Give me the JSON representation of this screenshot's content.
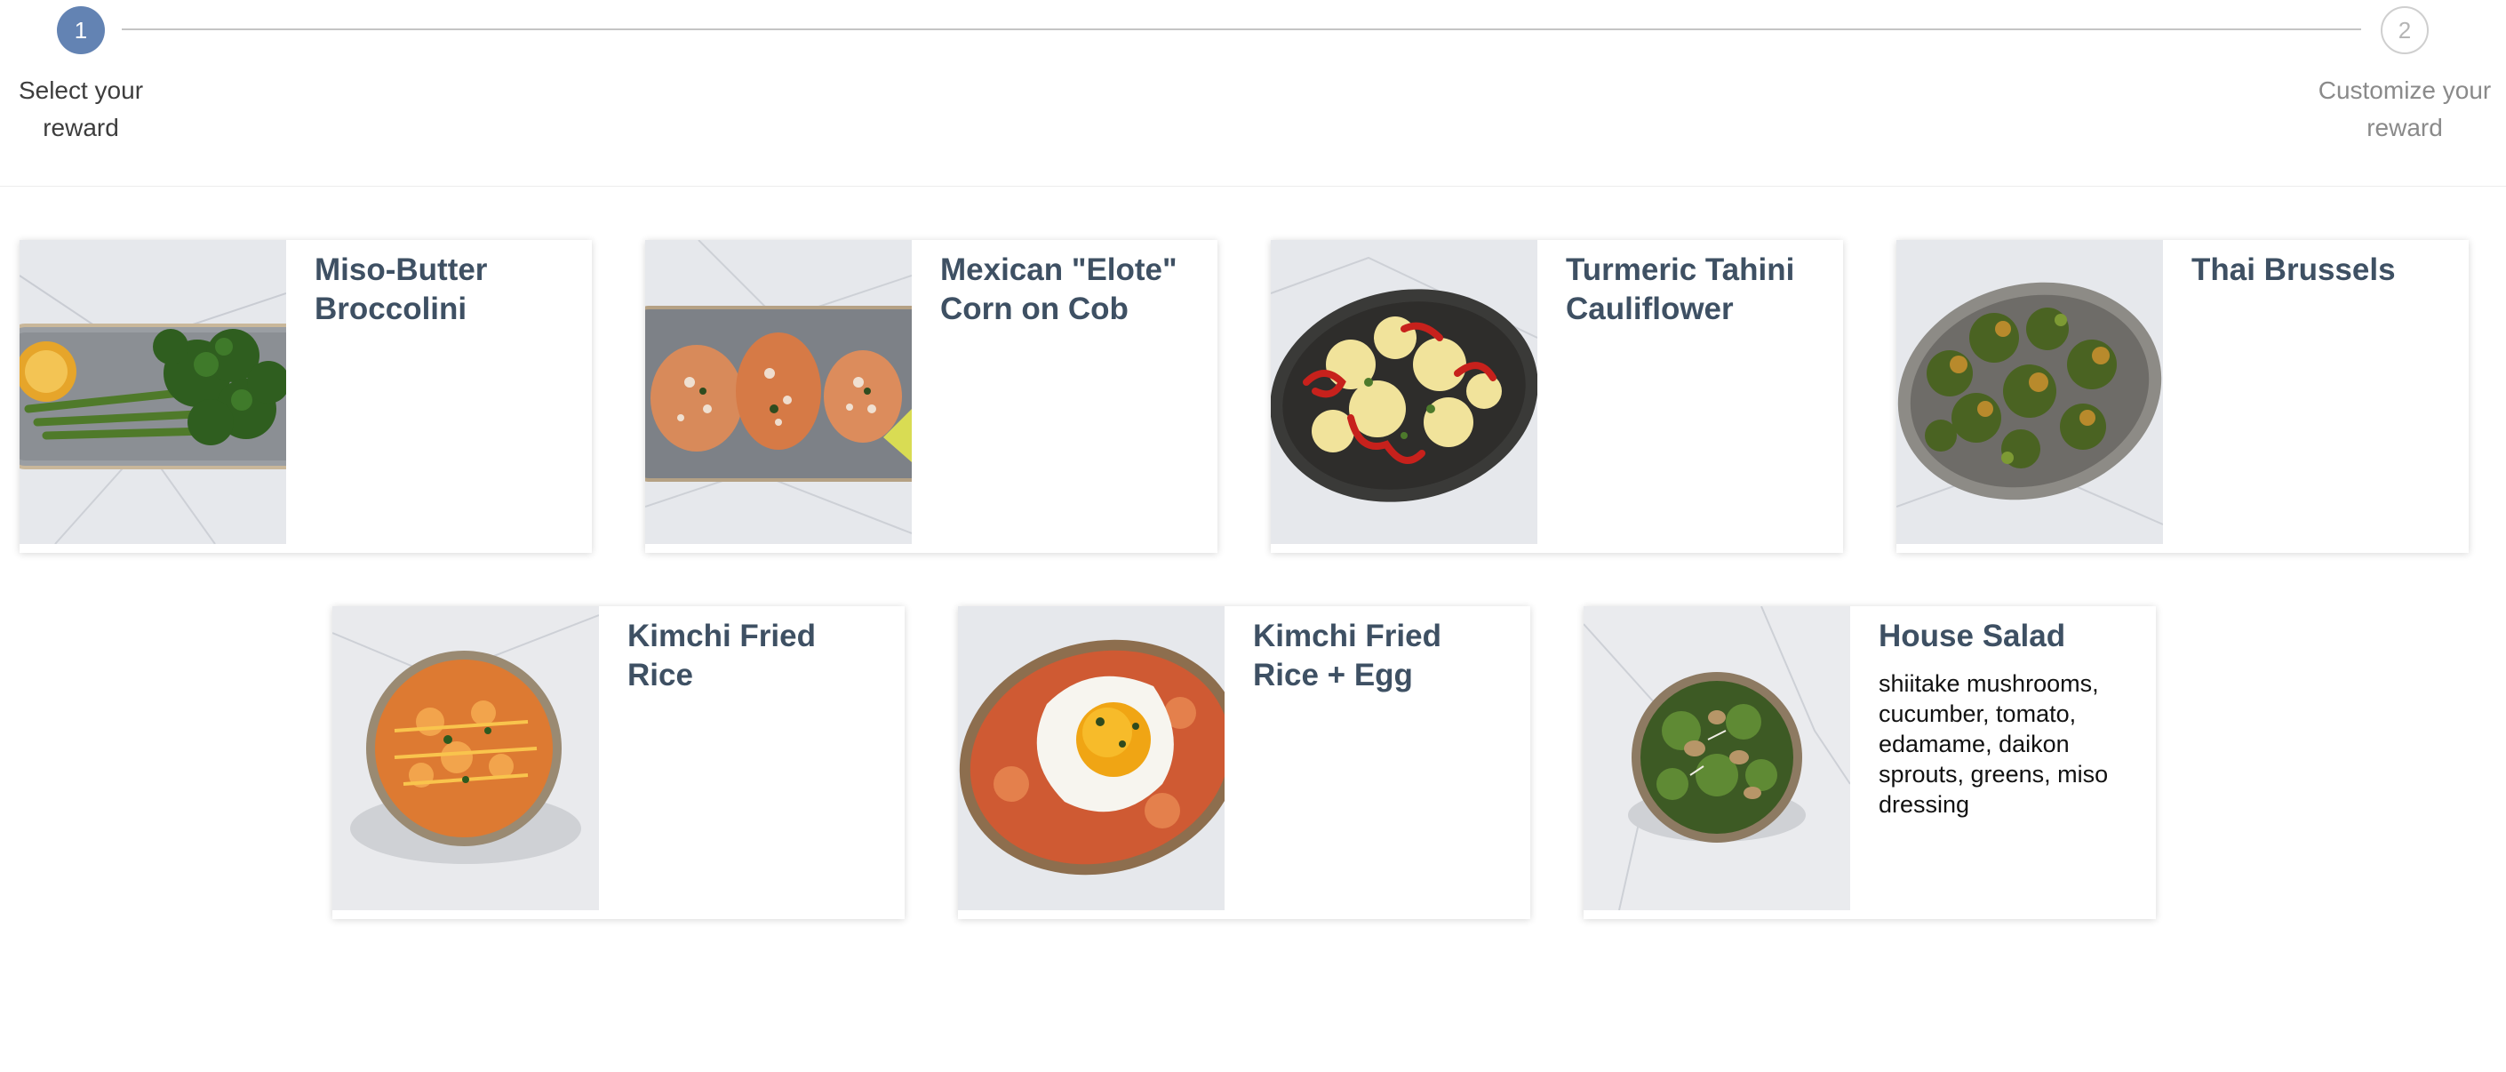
{
  "stepper": {
    "steps": [
      {
        "number": "1",
        "label_line1": "Select your",
        "label_line2": "reward",
        "active": true
      },
      {
        "number": "2",
        "label_line1": "Customize your",
        "label_line2": "reward",
        "active": false
      }
    ]
  },
  "rewards": [
    {
      "title": "Miso-Butter Broccolini",
      "description": ""
    },
    {
      "title": "Mexican \"Elote\" Corn on Cob",
      "description": ""
    },
    {
      "title": "Turmeric Tahini Cauliflower",
      "description": ""
    },
    {
      "title": "Thai Brussels",
      "description": ""
    },
    {
      "title": "Kimchi Fried Rice",
      "description": ""
    },
    {
      "title": "Kimchi Fried Rice + Egg",
      "description": ""
    },
    {
      "title": "House Salad",
      "description": "shiitake mushrooms, cucumber, tomato, edamame, daikon sprouts, greens, miso dressing"
    }
  ],
  "colors": {
    "accent": "#6383b3",
    "title": "#3e5063",
    "inactive_step": "#b5b5b5"
  }
}
